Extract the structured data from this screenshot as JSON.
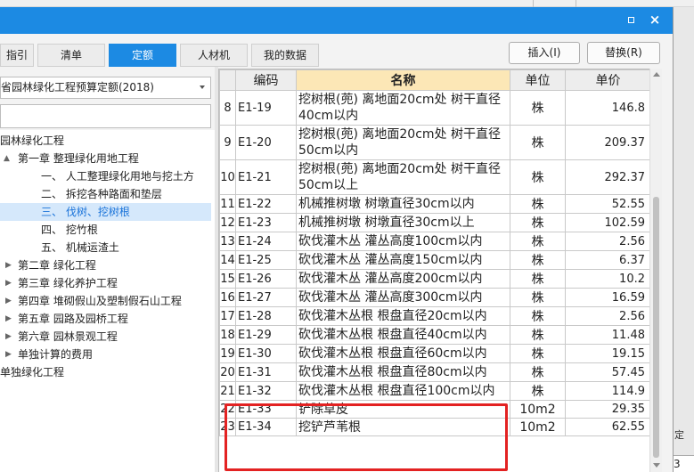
{
  "window": {
    "maximize_icon": "maximize-icon",
    "close_glyph": "×"
  },
  "tabs": [
    {
      "label": "指引",
      "active": false
    },
    {
      "label": "清单",
      "active": false
    },
    {
      "label": "定额",
      "active": true
    },
    {
      "label": "人材机",
      "active": false
    },
    {
      "label": "我的数据",
      "active": false
    }
  ],
  "buttons": {
    "insert": "插入(I)",
    "replace": "替换(R)"
  },
  "library_select": {
    "value": "省园林绿化工程预算定额(2018)"
  },
  "search": {
    "value": ""
  },
  "tree": [
    {
      "label": "园林绿化工程",
      "level": 0,
      "caret": ""
    },
    {
      "label": "第一章 整理绿化用地工程",
      "level": 1,
      "caret": "▲"
    },
    {
      "label": "一、 人工整理绿化用地与挖土方",
      "level": 2,
      "caret": ""
    },
    {
      "label": "二、 拆挖各种路面和垫层",
      "level": 2,
      "caret": ""
    },
    {
      "label": "三、 伐树、挖树根",
      "level": 2,
      "caret": "",
      "selected": true
    },
    {
      "label": "四、 挖竹根",
      "level": 2,
      "caret": ""
    },
    {
      "label": "五、 机械运渣土",
      "level": 2,
      "caret": ""
    },
    {
      "label": "第二章 绿化工程",
      "level": 1,
      "caret": "▶"
    },
    {
      "label": "第三章 绿化养护工程",
      "level": 1,
      "caret": "▶"
    },
    {
      "label": "第四章 堆砌假山及塑制假石山工程",
      "level": 1,
      "caret": "▶"
    },
    {
      "label": "第五章 园路及园桥工程",
      "level": 1,
      "caret": "▶"
    },
    {
      "label": "第六章 园林景观工程",
      "level": 1,
      "caret": "▶"
    },
    {
      "label": "单独计算的费用",
      "level": 1,
      "caret": "▶"
    },
    {
      "label": "单独绿化工程",
      "level": 0,
      "caret": ""
    }
  ],
  "grid": {
    "headers": {
      "code": "编码",
      "name": "名称",
      "unit": "单位",
      "price": "单价"
    },
    "rows": [
      {
        "no": "8",
        "code": "E1-19",
        "name": "挖树根(蔸) 离地面20cm处 树干直径40cm以内",
        "unit": "株",
        "price": "146.8"
      },
      {
        "no": "9",
        "code": "E1-20",
        "name": "挖树根(蔸) 离地面20cm处 树干直径50cm以内",
        "unit": "株",
        "price": "209.37"
      },
      {
        "no": "10",
        "code": "E1-21",
        "name": "挖树根(蔸) 离地面20cm处 树干直径50cm以上",
        "unit": "株",
        "price": "292.37"
      },
      {
        "no": "11",
        "code": "E1-22",
        "name": "机械推树墩 树墩直径30cm以内",
        "unit": "株",
        "price": "52.55"
      },
      {
        "no": "12",
        "code": "E1-23",
        "name": "机械推树墩 树墩直径30cm以上",
        "unit": "株",
        "price": "102.59"
      },
      {
        "no": "13",
        "code": "E1-24",
        "name": "砍伐灌木丛 灌丛高度100cm以内",
        "unit": "株",
        "price": "2.56"
      },
      {
        "no": "14",
        "code": "E1-25",
        "name": "砍伐灌木丛 灌丛高度150cm以内",
        "unit": "株",
        "price": "6.37"
      },
      {
        "no": "15",
        "code": "E1-26",
        "name": "砍伐灌木丛 灌丛高度200cm以内",
        "unit": "株",
        "price": "10.2"
      },
      {
        "no": "16",
        "code": "E1-27",
        "name": "砍伐灌木丛 灌丛高度300cm以内",
        "unit": "株",
        "price": "16.59"
      },
      {
        "no": "17",
        "code": "E1-28",
        "name": "砍伐灌木丛根 根盘直径20cm以内",
        "unit": "株",
        "price": "2.56"
      },
      {
        "no": "18",
        "code": "E1-29",
        "name": "砍伐灌木丛根 根盘直径40cm以内",
        "unit": "株",
        "price": "11.48"
      },
      {
        "no": "19",
        "code": "E1-30",
        "name": "砍伐灌木丛根 根盘直径60cm以内",
        "unit": "株",
        "price": "19.15"
      },
      {
        "no": "20",
        "code": "E1-31",
        "name": "砍伐灌木丛根 根盘直径80cm以内",
        "unit": "株",
        "price": "57.45"
      },
      {
        "no": "21",
        "code": "E1-32",
        "name": "砍伐灌木丛根 根盘直径100cm以内",
        "unit": "株",
        "price": "114.9"
      },
      {
        "no": "22",
        "code": "E1-33",
        "name": "铲除草皮",
        "unit": "10m2",
        "price": "29.35"
      },
      {
        "no": "23",
        "code": "E1-34",
        "name": "挖铲芦苇根",
        "unit": "10m2",
        "price": "62.55"
      }
    ]
  },
  "side_fragment": {
    "label_a": "定",
    "label_b": "3"
  },
  "colors": {
    "accent": "#1c8ae3",
    "highlight": "#e32222",
    "name_header": "#fce7b6"
  }
}
